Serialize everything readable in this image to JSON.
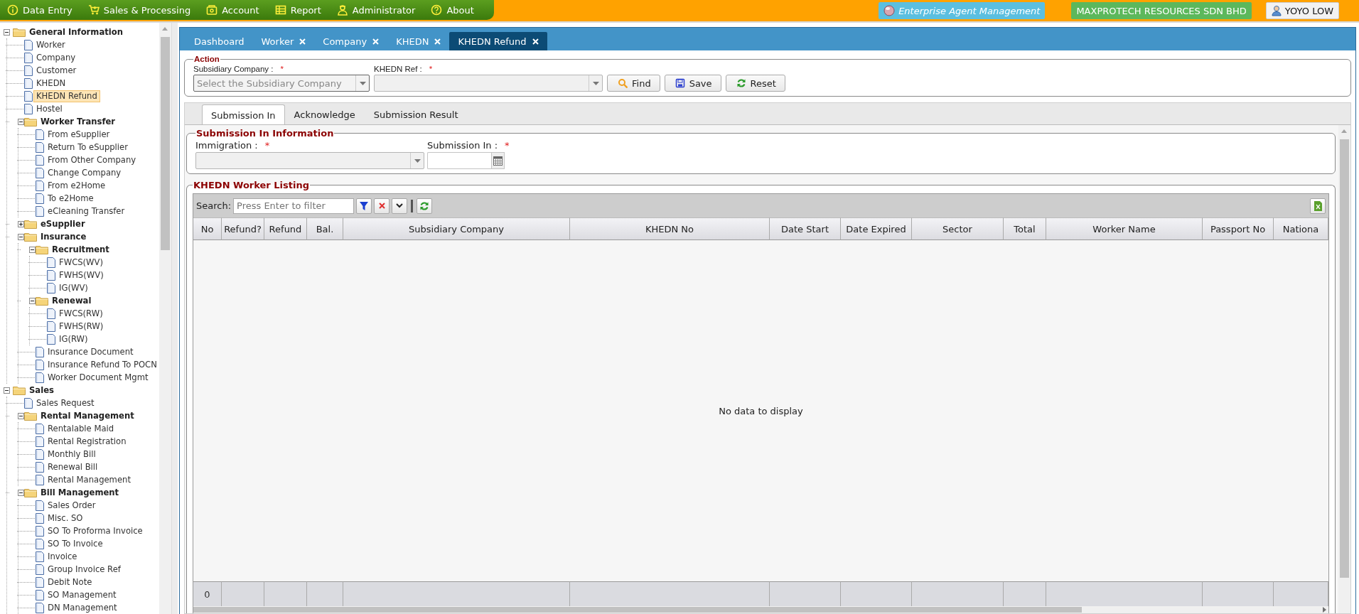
{
  "menu": [
    {
      "label": "Data Entry"
    },
    {
      "label": "Sales & Processing"
    },
    {
      "label": "Account"
    },
    {
      "label": "Report"
    },
    {
      "label": "Administrator"
    },
    {
      "label": "About"
    }
  ],
  "header": {
    "app_title": "Enterprise Agent Management",
    "company": "MAXPROTECH RESOURCES SDN BHD",
    "user": "YOYO LOW"
  },
  "sidebar": {
    "tree": [
      {
        "label": "General Information",
        "kind": "folder",
        "expanded": true,
        "children": [
          {
            "label": "Worker",
            "kind": "page",
            "selected": false
          },
          {
            "label": "Company",
            "kind": "page",
            "selected": false
          },
          {
            "label": "Customer",
            "kind": "page",
            "selected": false
          },
          {
            "label": "KHEDN",
            "kind": "page",
            "selected": false
          },
          {
            "label": "KHEDN Refund",
            "kind": "page",
            "selected": true
          },
          {
            "label": "Hostel",
            "kind": "page",
            "selected": false
          },
          {
            "label": "Worker Transfer",
            "kind": "folder",
            "expanded": true,
            "children": [
              {
                "label": "From eSupplier",
                "kind": "page",
                "selected": false
              },
              {
                "label": "Return To eSupplier",
                "kind": "page",
                "selected": false
              },
              {
                "label": "From Other Company",
                "kind": "page",
                "selected": false
              },
              {
                "label": "Change Company",
                "kind": "page",
                "selected": false
              },
              {
                "label": "From e2Home",
                "kind": "page",
                "selected": false
              },
              {
                "label": "To e2Home",
                "kind": "page",
                "selected": false
              },
              {
                "label": "eCleaning Transfer",
                "kind": "page",
                "selected": false
              }
            ]
          },
          {
            "label": "eSupplier",
            "kind": "folder",
            "expanded": false
          },
          {
            "label": "Insurance",
            "kind": "folder",
            "expanded": true,
            "children": [
              {
                "label": "Recruitment",
                "kind": "folder",
                "expanded": true,
                "children": [
                  {
                    "label": "FWCS(WV)",
                    "kind": "page",
                    "selected": false
                  },
                  {
                    "label": "FWHS(WV)",
                    "kind": "page",
                    "selected": false
                  },
                  {
                    "label": "IG(WV)",
                    "kind": "page",
                    "selected": false
                  }
                ]
              },
              {
                "label": "Renewal",
                "kind": "folder",
                "expanded": true,
                "children": [
                  {
                    "label": "FWCS(RW)",
                    "kind": "page",
                    "selected": false
                  },
                  {
                    "label": "FWHS(RW)",
                    "kind": "page",
                    "selected": false
                  },
                  {
                    "label": "IG(RW)",
                    "kind": "page",
                    "selected": false
                  }
                ]
              },
              {
                "label": "Insurance Document",
                "kind": "page",
                "selected": false
              },
              {
                "label": "Insurance Refund To POCN",
                "kind": "page",
                "selected": false
              },
              {
                "label": "Worker Document Mgmt",
                "kind": "page",
                "selected": false
              }
            ]
          }
        ]
      },
      {
        "label": "Sales",
        "kind": "folder",
        "expanded": true,
        "children": [
          {
            "label": "Sales Request",
            "kind": "page",
            "selected": false
          },
          {
            "label": "Rental Management",
            "kind": "folder",
            "expanded": true,
            "children": [
              {
                "label": "Rentalable Maid",
                "kind": "page",
                "selected": false
              },
              {
                "label": "Rental Registration",
                "kind": "page",
                "selected": false
              },
              {
                "label": "Monthly Bill",
                "kind": "page",
                "selected": false
              },
              {
                "label": "Renewal Bill",
                "kind": "page",
                "selected": false
              },
              {
                "label": "Rental Management",
                "kind": "page",
                "selected": false
              }
            ]
          },
          {
            "label": "Bill Management",
            "kind": "folder",
            "expanded": true,
            "children": [
              {
                "label": "Sales Order",
                "kind": "page",
                "selected": false
              },
              {
                "label": "Misc. SO",
                "kind": "page",
                "selected": false
              },
              {
                "label": "SO To Proforma Invoice",
                "kind": "page",
                "selected": false
              },
              {
                "label": "SO To Invoice",
                "kind": "page",
                "selected": false
              },
              {
                "label": "Invoice",
                "kind": "page",
                "selected": false
              },
              {
                "label": "Group Invoice Ref",
                "kind": "page",
                "selected": false
              },
              {
                "label": "Debit Note",
                "kind": "page",
                "selected": false
              },
              {
                "label": "SO Management",
                "kind": "page",
                "selected": false
              },
              {
                "label": "DN Management",
                "kind": "page",
                "selected": false
              }
            ]
          }
        ]
      }
    ]
  },
  "tabs": [
    {
      "label": "Dashboard",
      "closable": false,
      "selected": false
    },
    {
      "label": "Worker",
      "closable": true,
      "selected": false
    },
    {
      "label": "Company",
      "closable": true,
      "selected": false
    },
    {
      "label": "KHEDN",
      "closable": true,
      "selected": false
    },
    {
      "label": "KHEDN Refund",
      "closable": true,
      "selected": true
    }
  ],
  "action": {
    "title": "Action",
    "fields": [
      {
        "label": "Subsidiary Company :",
        "required_mark": "*",
        "placeholder": "Select the Subsidiary Company"
      },
      {
        "label": "KHEDN Ref :",
        "required_mark": "*"
      }
    ],
    "buttons": [
      {
        "label": "Find"
      },
      {
        "label": "Save"
      },
      {
        "label": "Reset"
      }
    ]
  },
  "subtabs": [
    {
      "label": "Submission In",
      "selected": true
    },
    {
      "label": "Acknowledge",
      "selected": false
    },
    {
      "label": "Submission Result",
      "selected": false
    }
  ],
  "submission_info": {
    "title": "Submission In Information",
    "fields": [
      {
        "label": "Immigration :",
        "required_mark": "*",
        "kind": "select"
      },
      {
        "label": "Submission In :",
        "required_mark": "*",
        "kind": "date"
      }
    ]
  },
  "listing": {
    "title": "KHEDN Worker Listing",
    "search_label": "Search:",
    "search_placeholder": "Press Enter to filter",
    "columns": [
      "No",
      "Refund?",
      "Refund",
      "Bal.",
      "Subsidiary Company",
      "KHEDN No",
      "Date Start",
      "Date Expired",
      "Sector",
      "Total",
      "Worker Name",
      "Passport No",
      "Nationa"
    ],
    "empty_message": "No data to display",
    "footer_count": "0"
  }
}
